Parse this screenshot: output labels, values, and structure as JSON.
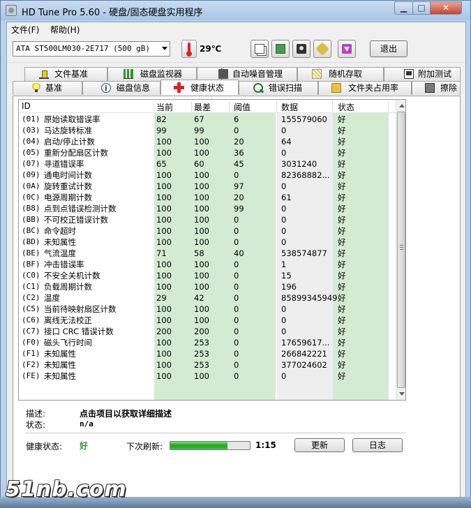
{
  "window": {
    "title": "HD Tune Pro 5.60 - 硬盘/固态硬盘实用程序"
  },
  "menu": {
    "file": "文件(F)",
    "help": "帮助(H)"
  },
  "toolbar": {
    "drive": "ATA    ST500LM030-2E717 (500 gB)",
    "temperature": "29℃",
    "exit_label": "退出"
  },
  "tabs_top": [
    "文件基准",
    "磁盘监视器",
    "自动噪音管理",
    "随机存取",
    "附加测试"
  ],
  "tabs_bottom": [
    "基准",
    "磁盘信息",
    "健康状态",
    "错误扫描",
    "文件夹占用率",
    "擦除"
  ],
  "active_tab": "健康状态",
  "table": {
    "headers": [
      "ID",
      "当前",
      "最差",
      "阈值",
      "数据",
      "状态"
    ],
    "rows": [
      {
        "id": "(01)",
        "name": "原始读取错误率",
        "cur": "82",
        "worst": "67",
        "thr": "6",
        "data": "155579060",
        "status": "好"
      },
      {
        "id": "(03)",
        "name": "马达旋转标准",
        "cur": "99",
        "worst": "99",
        "thr": "0",
        "data": "0",
        "status": "好"
      },
      {
        "id": "(04)",
        "name": "启动/停止计数",
        "cur": "100",
        "worst": "100",
        "thr": "20",
        "data": "64",
        "status": "好"
      },
      {
        "id": "(05)",
        "name": "重新分配扇区计数",
        "cur": "100",
        "worst": "100",
        "thr": "36",
        "data": "0",
        "status": "好"
      },
      {
        "id": "(07)",
        "name": "寻道错误率",
        "cur": "65",
        "worst": "60",
        "thr": "45",
        "data": "3031240",
        "status": "好"
      },
      {
        "id": "(09)",
        "name": "通电时间计数",
        "cur": "100",
        "worst": "100",
        "thr": "0",
        "data": "82368882...",
        "status": "好"
      },
      {
        "id": "(0A)",
        "name": "旋转重试计数",
        "cur": "100",
        "worst": "100",
        "thr": "97",
        "data": "0",
        "status": "好"
      },
      {
        "id": "(0C)",
        "name": "电源周期计数",
        "cur": "100",
        "worst": "100",
        "thr": "20",
        "data": "61",
        "status": "好"
      },
      {
        "id": "(B8)",
        "name": "点到点错误检测计数",
        "cur": "100",
        "worst": "100",
        "thr": "99",
        "data": "0",
        "status": "好"
      },
      {
        "id": "(BB)",
        "name": "不可校正错误计数",
        "cur": "100",
        "worst": "100",
        "thr": "0",
        "data": "0",
        "status": "好"
      },
      {
        "id": "(BC)",
        "name": "命令超时",
        "cur": "100",
        "worst": "100",
        "thr": "0",
        "data": "0",
        "status": "好"
      },
      {
        "id": "(BD)",
        "name": "未知属性",
        "cur": "100",
        "worst": "100",
        "thr": "0",
        "data": "0",
        "status": "好"
      },
      {
        "id": "(BE)",
        "name": "气流温度",
        "cur": "71",
        "worst": "58",
        "thr": "40",
        "data": "538574877",
        "status": "好"
      },
      {
        "id": "(BF)",
        "name": "冲击错误率",
        "cur": "100",
        "worst": "100",
        "thr": "0",
        "data": "1",
        "status": "好"
      },
      {
        "id": "(C0)",
        "name": "不安全关机计数",
        "cur": "100",
        "worst": "100",
        "thr": "0",
        "data": "15",
        "status": "好"
      },
      {
        "id": "(C1)",
        "name": "负载周期计数",
        "cur": "100",
        "worst": "100",
        "thr": "0",
        "data": "196",
        "status": "好"
      },
      {
        "id": "(C2)",
        "name": "温度",
        "cur": "29",
        "worst": "42",
        "thr": "0",
        "data": "85899345949",
        "status": "好"
      },
      {
        "id": "(C5)",
        "name": "当前待映射扇区计数",
        "cur": "100",
        "worst": "100",
        "thr": "0",
        "data": "0",
        "status": "好"
      },
      {
        "id": "(C6)",
        "name": "离线无法校正",
        "cur": "100",
        "worst": "100",
        "thr": "0",
        "data": "0",
        "status": "好"
      },
      {
        "id": "(C7)",
        "name": "接口 CRC 错误计数",
        "cur": "200",
        "worst": "200",
        "thr": "0",
        "data": "0",
        "status": "好"
      },
      {
        "id": "(F0)",
        "name": "磁头飞行时间",
        "cur": "100",
        "worst": "253",
        "thr": "0",
        "data": "17659617...",
        "status": "好"
      },
      {
        "id": "(F1)",
        "name": "未知属性",
        "cur": "100",
        "worst": "253",
        "thr": "0",
        "data": "266842221",
        "status": "好"
      },
      {
        "id": "(F2)",
        "name": "未知属性",
        "cur": "100",
        "worst": "253",
        "thr": "0",
        "data": "377024602",
        "status": "好"
      },
      {
        "id": "(FE)",
        "name": "未知属性",
        "cur": "100",
        "worst": "100",
        "thr": "0",
        "data": "0",
        "status": "好"
      }
    ]
  },
  "details": {
    "desc_label": "描述:",
    "desc_value": "点击项目以获取详细描述",
    "state_label": "状态:",
    "state_value": "n/a"
  },
  "footer": {
    "health_label": "健康状态:",
    "health_value": "好",
    "refresh_label": "下次刷新:",
    "refresh_progress": 0.72,
    "timer": "1:15",
    "refresh_button": "更新",
    "log_button": "日志"
  },
  "watermark": "51nb.com",
  "colors": {
    "col_cur_bg": "#d3ebd3",
    "col_data_bg": "#eeeeee",
    "col_status_bg": "#d3ebd3",
    "health_good": "#2a9a2a"
  }
}
